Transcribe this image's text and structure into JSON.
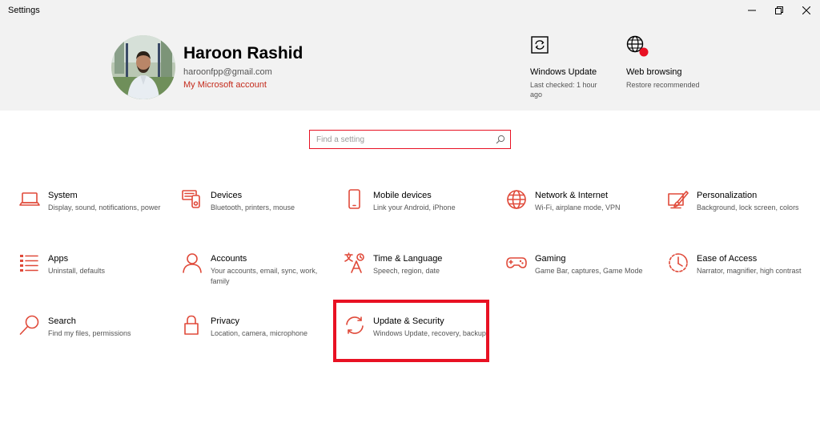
{
  "window": {
    "title": "Settings"
  },
  "profile": {
    "name": "Haroon Rashid",
    "email": "haroonfpp@gmail.com",
    "account_link": "My Microsoft account"
  },
  "quick_actions": [
    {
      "title": "Windows Update",
      "subtitle": "Last checked: 1 hour ago",
      "icon": "windows-update-icon"
    },
    {
      "title": "Web browsing",
      "subtitle": "Restore recommended",
      "icon": "globe-alert-icon"
    }
  ],
  "search": {
    "placeholder": "Find a setting",
    "value": ""
  },
  "categories": [
    {
      "title": "System",
      "desc": "Display, sound, notifications, power",
      "icon": "laptop-icon"
    },
    {
      "title": "Devices",
      "desc": "Bluetooth, printers, mouse",
      "icon": "devices-icon"
    },
    {
      "title": "Mobile devices",
      "desc": "Link your Android, iPhone",
      "icon": "phone-icon"
    },
    {
      "title": "Network & Internet",
      "desc": "Wi-Fi, airplane mode, VPN",
      "icon": "globe-icon"
    },
    {
      "title": "Personalization",
      "desc": "Background, lock screen, colors",
      "icon": "paintbrush-icon"
    },
    {
      "title": "Apps",
      "desc": "Uninstall, defaults",
      "icon": "apps-list-icon"
    },
    {
      "title": "Accounts",
      "desc": "Your accounts, email, sync, work, family",
      "icon": "person-icon"
    },
    {
      "title": "Time & Language",
      "desc": "Speech, region, date",
      "icon": "time-language-icon"
    },
    {
      "title": "Gaming",
      "desc": "Game Bar, captures, Game Mode",
      "icon": "gamepad-icon"
    },
    {
      "title": "Ease of Access",
      "desc": "Narrator, magnifier, high contrast",
      "icon": "ease-of-access-icon"
    },
    {
      "title": "Search",
      "desc": "Find my files, permissions",
      "icon": "search-icon"
    },
    {
      "title": "Privacy",
      "desc": "Location, camera, microphone",
      "icon": "lock-icon"
    },
    {
      "title": "Update & Security",
      "desc": "Windows Update, recovery, backup",
      "icon": "sync-icon"
    }
  ],
  "colors": {
    "accent": "#e04a3a",
    "highlight": "#e81123",
    "header_bg": "#f2f2f2"
  }
}
